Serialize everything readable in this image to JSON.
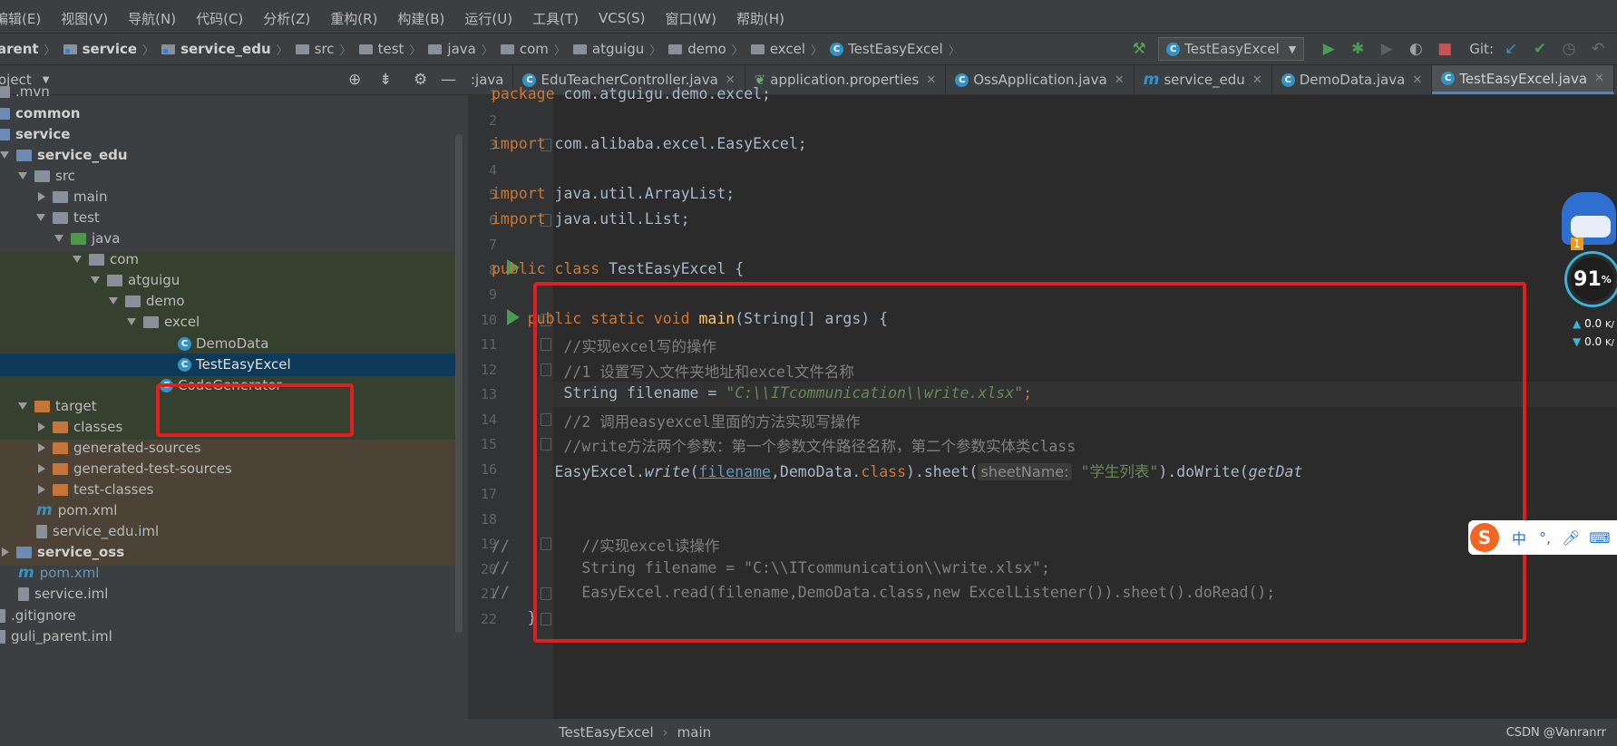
{
  "menu": [
    "编辑(E)",
    "视图(V)",
    "导航(N)",
    "代码(C)",
    "分析(Z)",
    "重构(R)",
    "构建(B)",
    "运行(U)",
    "工具(T)",
    "VCS(S)",
    "窗口(W)",
    "帮助(H)"
  ],
  "breadcrumb": [
    "arent",
    "service",
    "service_edu",
    "src",
    "test",
    "java",
    "com",
    "atguigu",
    "demo",
    "excel",
    "TestEasyExcel"
  ],
  "toolbar": {
    "run_config": "TestEasyExcel",
    "git_label": "Git:"
  },
  "project_panel": {
    "title": "oject",
    "tree": [
      {
        "label": ".mvn"
      },
      {
        "label": "common"
      },
      {
        "label": "service"
      },
      {
        "label": "service_edu"
      },
      {
        "label": "src"
      },
      {
        "label": "main"
      },
      {
        "label": "test"
      },
      {
        "label": "java"
      },
      {
        "label": "com"
      },
      {
        "label": "atguigu"
      },
      {
        "label": "demo"
      },
      {
        "label": "excel"
      },
      {
        "label": "DemoData"
      },
      {
        "label": "TestEasyExcel"
      },
      {
        "label": "CodeGenerator"
      },
      {
        "label": "target"
      },
      {
        "label": "classes"
      },
      {
        "label": "generated-sources"
      },
      {
        "label": "generated-test-sources"
      },
      {
        "label": "test-classes"
      },
      {
        "label": "pom.xml"
      },
      {
        "label": "service_edu.iml"
      },
      {
        "label": "service_oss"
      },
      {
        "label": "pom.xml"
      },
      {
        "label": "service.iml"
      },
      {
        "label": ".gitignore"
      },
      {
        "label": "guli_parent.iml"
      }
    ]
  },
  "tabs": [
    {
      "label": ":java"
    },
    {
      "label": "EduTeacherController.java"
    },
    {
      "label": "application.properties"
    },
    {
      "label": "OssApplication.java"
    },
    {
      "label": "service_edu"
    },
    {
      "label": "DemoData.java"
    },
    {
      "label": "TestEasyExcel.java"
    }
  ],
  "code": {
    "line_numbers": [
      "1",
      "2",
      "3",
      "4",
      "5",
      "6",
      "7",
      "8",
      "9",
      "10",
      "11",
      "12",
      "13",
      "14",
      "15",
      "16",
      "17",
      "18",
      "19",
      "20",
      "21",
      "22"
    ],
    "l1_kw": "package",
    "l1_rest": " com.atguigu.demo.excel;",
    "l3_kw": "import",
    "l3_rest": " com.alibaba.excel.EasyExcel;",
    "l5_kw": "import",
    "l5_rest": " java.util.ArrayList;",
    "l6_kw": "import",
    "l6_rest": " java.util.List;",
    "l8_kw": "public class",
    "l8_rest": " TestEasyExcel {",
    "l10_kw": "    public static void",
    "l10_fn": " main",
    "l10_rest": "(String[] args) {",
    "l11": "        //实现excel写的操作",
    "l12": "        //1 设置写入文件夹地址和excel文件名称",
    "l13_a": "        String filename = ",
    "l13_str": "\"C:\\\\ITcommunication\\\\write.xlsx\"",
    "l13_end": ";",
    "l14": "        //2 调用easyexcel里面的方法实现写操作",
    "l15": "        //write方法两个参数：第一个参数文件路径名称，第二个参数实体类class",
    "l16_a": "       EasyExcel.",
    "l16_write": "write",
    "l16_b": "(",
    "l16_fn": "filename",
    "l16_c": ",DemoData.",
    "l16_cls": "class",
    "l16_d": ").sheet(",
    "l16_hint": "sheetName:",
    "l16_str": " \"学生列表\"",
    "l16_e": ").doWrite(",
    "l16_get": "getDat",
    "l19": "//        //实现excel读操作",
    "l20": "//        String filename = \"C:\\\\ITcommunication\\\\write.xlsx\";",
    "l21": "//        EasyExcel.read(filename,DemoData.class,new ExcelListener()).sheet().doRead();",
    "l22": "    }"
  },
  "status": {
    "crumb1": "TestEasyExcel",
    "crumb2": "main"
  },
  "widget": {
    "badge": "1",
    "percent": "91",
    "percent_sign": "%",
    "up": "0.0",
    "up_unit": "K/",
    "down": "0.0",
    "down_unit": "K/"
  },
  "ime": {
    "label": "中"
  },
  "watermark": "CSDN @Vanranrr"
}
